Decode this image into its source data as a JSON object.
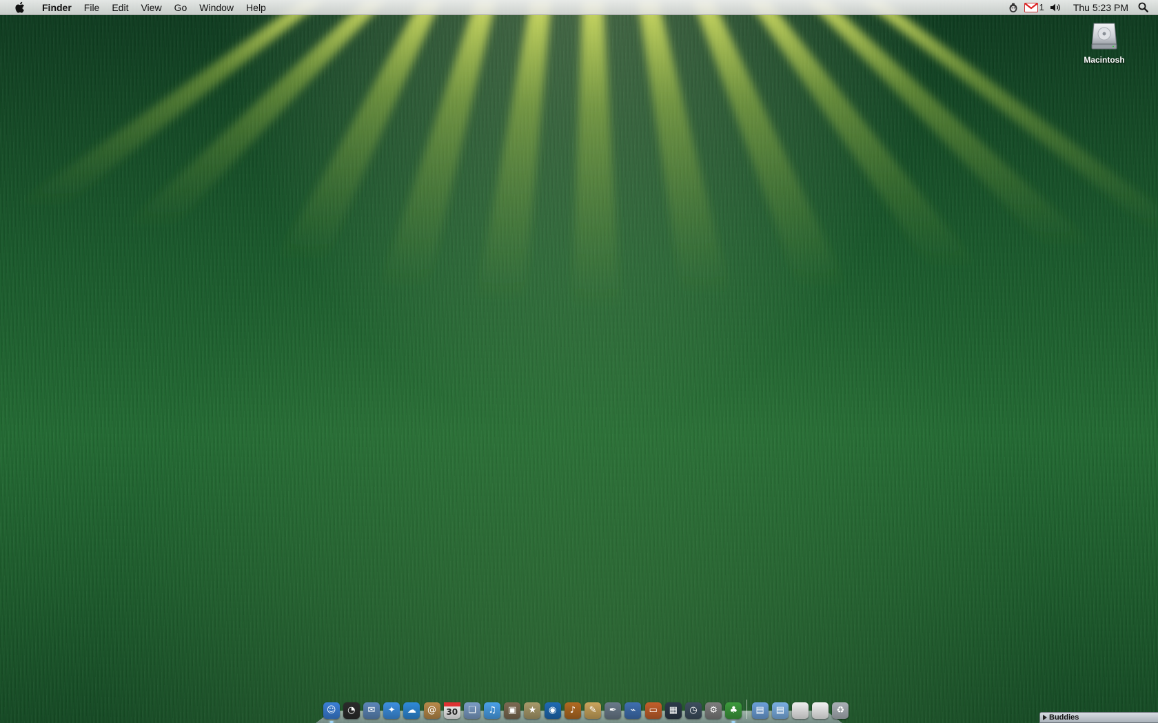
{
  "menubar": {
    "app_name": "Finder",
    "menus": [
      "File",
      "Edit",
      "View",
      "Go",
      "Window",
      "Help"
    ],
    "mail_count": "1",
    "clock": "Thu 5:23 PM"
  },
  "desktop": {
    "icons": [
      {
        "label": "Macintosh"
      }
    ]
  },
  "dock": {
    "calendar_day": "30",
    "apps": [
      {
        "name": "finder-icon",
        "color": "#3b7fd6",
        "glyph": "☺",
        "running": true
      },
      {
        "name": "dashboard-icon",
        "color": "#2b2b2b",
        "glyph": "◔",
        "running": false
      },
      {
        "name": "mail-icon",
        "color": "#5c86b8",
        "glyph": "✉",
        "running": false
      },
      {
        "name": "safari-icon",
        "color": "#3d8fe0",
        "glyph": "✦",
        "running": false
      },
      {
        "name": "ichat-icon",
        "color": "#2f8ad8",
        "glyph": "☁",
        "running": false
      },
      {
        "name": "address-book-icon",
        "color": "#b88a4a",
        "glyph": "@",
        "running": false
      },
      {
        "name": "ical-icon",
        "color": "#f4f4f4",
        "glyph": "",
        "running": false
      },
      {
        "name": "preview-icon",
        "color": "#7a9bc4",
        "glyph": "❏",
        "running": false
      },
      {
        "name": "itunes-icon",
        "color": "#4aa0e8",
        "glyph": "♫",
        "running": false
      },
      {
        "name": "iphoto-icon",
        "color": "#7c6a52",
        "glyph": "▣",
        "running": false
      },
      {
        "name": "imovie-icon",
        "color": "#a89a6a",
        "glyph": "★",
        "running": false
      },
      {
        "name": "idvd-icon",
        "color": "#1e6ab3",
        "glyph": "◉",
        "running": false
      },
      {
        "name": "garageband-icon",
        "color": "#b06a22",
        "glyph": "♪",
        "running": false
      },
      {
        "name": "iweb-icon",
        "color": "#c9a45c",
        "glyph": "✎",
        "running": false
      },
      {
        "name": "script-editor-icon",
        "color": "#6a7a8a",
        "glyph": "✒",
        "running": false
      },
      {
        "name": "grapher-icon",
        "color": "#3f6fb0",
        "glyph": "⌁",
        "running": false
      },
      {
        "name": "keynote-icon",
        "color": "#c25f2b",
        "glyph": "▭",
        "running": false
      },
      {
        "name": "spaces-icon",
        "color": "#2d3a4a",
        "glyph": "▦",
        "running": false
      },
      {
        "name": "time-machine-icon",
        "color": "#3d4e5e",
        "glyph": "◷",
        "running": false
      },
      {
        "name": "system-preferences-icon",
        "color": "#7d7d7d",
        "glyph": "⚙",
        "running": false
      },
      {
        "name": "adium-icon",
        "color": "#3c9a3c",
        "glyph": "♣",
        "running": true
      }
    ],
    "stacks": [
      {
        "name": "applications-folder-icon",
        "color": "#6c9fd8",
        "glyph": "▤"
      },
      {
        "name": "documents-folder-icon",
        "color": "#7aaee2",
        "glyph": "▤"
      },
      {
        "name": "document-stack-icon",
        "color": "#eeeeee",
        "glyph": ""
      },
      {
        "name": "downloads-stack-icon",
        "color": "#f2f2f2",
        "glyph": ""
      },
      {
        "name": "trash-icon",
        "color": "#aab0b6",
        "glyph": "♻"
      }
    ]
  },
  "buddies_window": {
    "title": "Buddies"
  }
}
